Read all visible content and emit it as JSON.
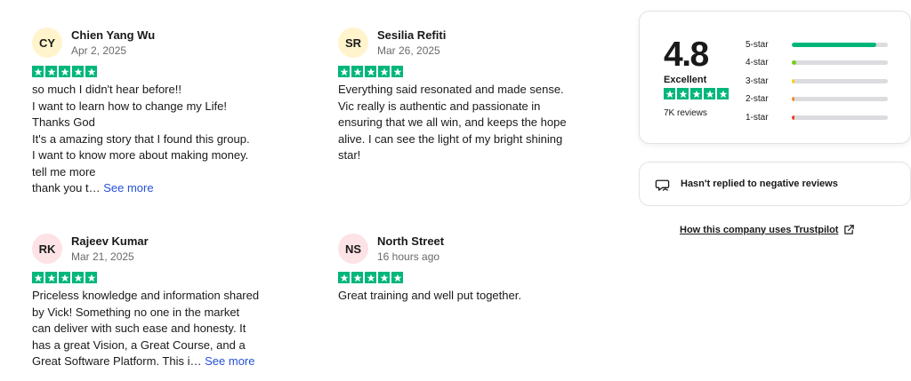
{
  "reviews": [
    {
      "initials": "CY",
      "avatar_color": "#fff4cc",
      "name": "Chien Yang Wu",
      "date": "Apr 2, 2025",
      "rating": 5,
      "lines": [
        "so much I didn't hear before!!",
        "I want to learn how to change my Life!",
        "Thanks God",
        "It's a amazing story that I found this group.",
        "I want to know more about making money.",
        "tell me more"
      ],
      "last_line": "thank you t…",
      "see_more": "See more"
    },
    {
      "initials": "SR",
      "avatar_color": "#fff4cc",
      "name": "Sesilia Refiti",
      "date": "Mar 26, 2025",
      "rating": 5,
      "lines": [
        "Everything said resonated and made sense.",
        "Vic really is authentic and passionate in",
        "ensuring that we all win, and keeps the hope",
        "alive. I can see the light of my bright shining",
        "star!"
      ]
    },
    {
      "initials": "RK",
      "avatar_color": "#fde2e6",
      "name": "Rajeev Kumar",
      "date": "Mar 21, 2025",
      "rating": 5,
      "lines": [
        "Priceless knowledge and information shared",
        "by Vick! Something no one in the market",
        "can deliver with such ease and honesty. It",
        "has a great Vision, a Great Course, and a"
      ],
      "last_line": "Great Software Platform. This i…",
      "see_more": "See more"
    },
    {
      "initials": "NS",
      "avatar_color": "#fde2e6",
      "name": "North Street",
      "date": "16 hours ago",
      "rating": 5,
      "lines": [
        "Great training and well put together."
      ]
    }
  ],
  "summary": {
    "score": "4.8",
    "label": "Excellent",
    "rating": 5,
    "review_count": "7K reviews",
    "distribution": [
      {
        "label": "5-star",
        "fraction": 0.88,
        "color": "#00b67a"
      },
      {
        "label": "4-star",
        "fraction": 0.05,
        "color": "#73cf11"
      },
      {
        "label": "3-star",
        "fraction": 0.015,
        "color": "#ffce00"
      },
      {
        "label": "2-star",
        "fraction": 0.01,
        "color": "#ff8622"
      },
      {
        "label": "1-star",
        "fraction": 0.015,
        "color": "#ff3722"
      }
    ]
  },
  "negative_notice": {
    "text": "Hasn't replied to negative reviews",
    "icon": "speech-bubble-icon"
  },
  "how_link": {
    "text": "How this company uses Trustpilot",
    "icon": "external-link-icon"
  },
  "colors": {
    "star_green": "#00b67a",
    "link_blue": "#2750d8"
  }
}
